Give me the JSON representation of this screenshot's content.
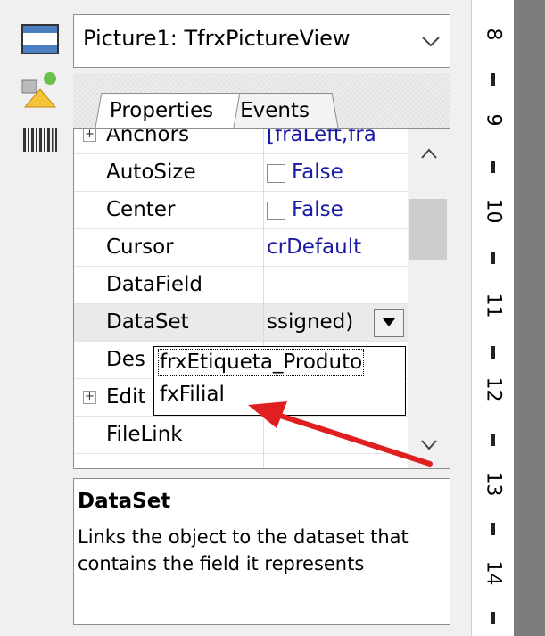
{
  "object_selector": {
    "value": "Picture1: TfrxPictureView"
  },
  "tabs": [
    {
      "label": "Properties",
      "active": true
    },
    {
      "label": "Events",
      "active": false
    }
  ],
  "properties": [
    {
      "name": "Anchors",
      "value": "[fraLeft,fra",
      "expandable": true
    },
    {
      "name": "AutoSize",
      "value": "False",
      "checkbox": true
    },
    {
      "name": "Center",
      "value": "False",
      "checkbox": true
    },
    {
      "name": "Cursor",
      "value": "crDefault"
    },
    {
      "name": "DataField",
      "value": ""
    },
    {
      "name": "DataSet",
      "value": "ssigned)",
      "selected": true
    },
    {
      "name": "Des",
      "value": ""
    },
    {
      "name": "Edit",
      "value": "",
      "expandable": true
    },
    {
      "name": "FileLink",
      "value": ""
    }
  ],
  "dataset_dropdown": {
    "options": [
      "frxEtiqueta_Produto",
      "fxFilial"
    ],
    "focused_index": 0
  },
  "description": {
    "title": "DataSet",
    "text": "Links the object to the dataset that contains the field it represents"
  },
  "ruler": {
    "numbers": [
      "8",
      "9",
      "10",
      "11",
      "12",
      "13",
      "14"
    ]
  },
  "colors": {
    "value_text": "#1a1aa6",
    "annotation_arrow": "#e02020",
    "workspace_gray": "#7c7c7c"
  },
  "icons": [
    "band-icon",
    "shape-icon",
    "barcode-icon",
    "chevron-down-icon",
    "scroll-up-icon",
    "scroll-down-icon",
    "dropdown-arrow-icon"
  ]
}
